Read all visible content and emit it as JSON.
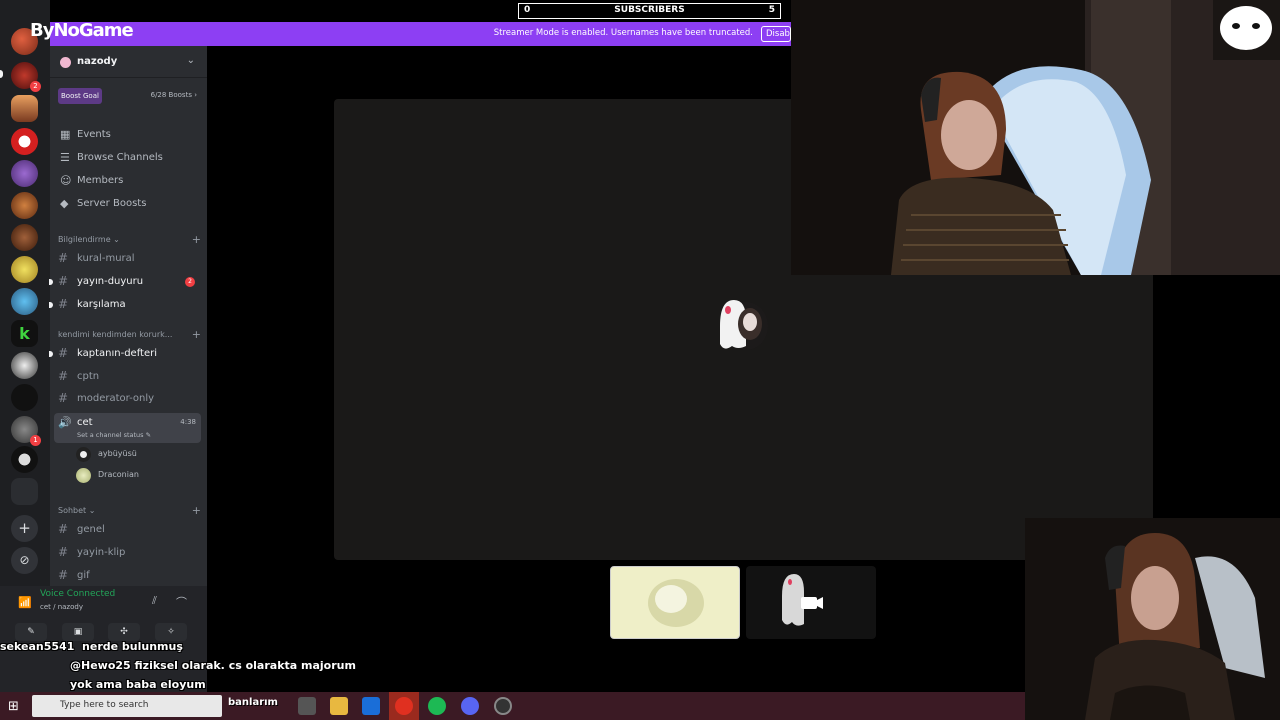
{
  "overlay": {
    "logo": "ByNoGame",
    "subscribers": {
      "current": "0",
      "label": "SUBSCRIBERS",
      "goal": "5"
    }
  },
  "streamer_mode": {
    "message": "Streamer Mode is enabled. Usernames have been truncated.",
    "button": "Disable"
  },
  "server": {
    "name": "nazody",
    "boost_goal_label": "Boost Goal",
    "boost_count": "6/28 Boosts",
    "menu": [
      {
        "label": "Events",
        "icon": "calendar-icon"
      },
      {
        "label": "Browse Channels",
        "icon": "browse-icon"
      },
      {
        "label": "Members",
        "icon": "members-icon"
      },
      {
        "label": "Server Boosts",
        "icon": "boost-icon"
      }
    ],
    "categories": [
      {
        "label": "Bilgilendirme",
        "channels": [
          {
            "name": "kural-mural",
            "unread": false,
            "mention": ""
          },
          {
            "name": "yayın-duyuru",
            "unread": true,
            "mention": "2"
          },
          {
            "name": "karşılama",
            "unread": true,
            "mention": ""
          }
        ]
      },
      {
        "label": "kendimi kendimden korurk...",
        "channels": [
          {
            "name": "kaptanın-defteri",
            "unread": true,
            "mention": ""
          },
          {
            "name": "cptn",
            "unread": false,
            "mention": ""
          },
          {
            "name": "moderator-only",
            "unread": false,
            "mention": ""
          }
        ]
      },
      {
        "label": "Sohbet",
        "channels": [
          {
            "name": "genel",
            "unread": false,
            "mention": ""
          },
          {
            "name": "yayin-klip",
            "unread": false,
            "mention": ""
          },
          {
            "name": "gif",
            "unread": false,
            "mention": ""
          }
        ]
      }
    ],
    "voice_channel": {
      "name": "cet",
      "time": "4:38",
      "status": "Set a channel status",
      "users": [
        "aybüyüsü",
        "Draconian"
      ]
    }
  },
  "voice_panel": {
    "title": "Voice Connected",
    "subtitle": "cet / nazody"
  },
  "chat": [
    {
      "user": "sekean5541",
      "message": "nerde bulunmuş"
    },
    {
      "user": "",
      "message": "@Hewo25 fiziksel olarak. cs olaraktа majorum"
    },
    {
      "user": "",
      "message": "yok ama baba eloyum"
    },
    {
      "user": "",
      "message": "banlarım"
    }
  ],
  "taskbar": {
    "search_placeholder": "Type here to search"
  },
  "colors": {
    "discord_bg": "#313338",
    "sidebar": "#2b2d31",
    "rail": "#1e1f22",
    "streamer_bar": "#8d3ff3",
    "online_green": "#23a559",
    "mention_red": "#f23f43",
    "taskbar": "#3b1a24"
  }
}
